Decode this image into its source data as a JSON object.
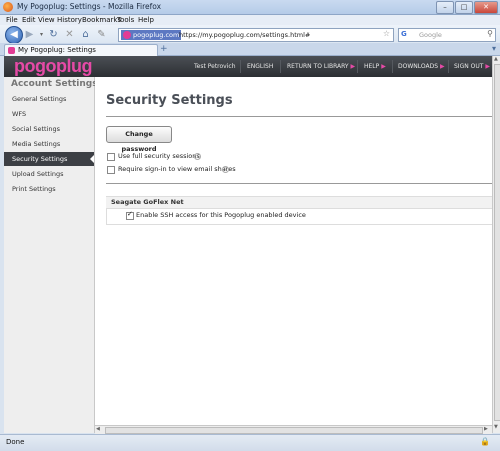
{
  "window": {
    "title": "My Pogoplug: Settings - Mozilla Firefox"
  },
  "menu": [
    "File",
    "Edit",
    "View",
    "History",
    "Bookmarks",
    "Tools",
    "Help"
  ],
  "toolbar": {
    "site_identity": "pogoplug.com",
    "url": "https://my.pogoplug.com/settings.html#",
    "search_placeholder": "Google"
  },
  "tab": {
    "label": "My Pogoplug: Settings"
  },
  "header": {
    "logo": "pogoplug",
    "user": "Test Petrovich",
    "links": [
      "ENGLISH",
      "RETURN TO LIBRARY",
      "HELP",
      "DOWNLOADS",
      "SIGN OUT"
    ]
  },
  "sidebar": {
    "title": "Account Settings",
    "items": [
      {
        "label": "General Settings"
      },
      {
        "label": "WFS"
      },
      {
        "label": "Social Settings"
      },
      {
        "label": "Media Settings"
      },
      {
        "label": "Security Settings",
        "active": true
      },
      {
        "label": "Upload Settings"
      },
      {
        "label": "Print Settings"
      }
    ]
  },
  "main": {
    "title": "Security Settings",
    "change_password": "Change password",
    "options": [
      {
        "label": "Use full security sessions",
        "checked": false
      },
      {
        "label": "Require sign-in to view email shares",
        "checked": false
      }
    ],
    "section": {
      "title": "Seagate GoFlex Net",
      "option": {
        "label": "Enable SSH access for this Pogoplug enabled device",
        "checked": true
      }
    }
  },
  "status": {
    "text": "Done"
  },
  "colors": {
    "accent": "#e54aa6",
    "header": "#2c2f33",
    "sidebar_active": "#3c3f44"
  }
}
